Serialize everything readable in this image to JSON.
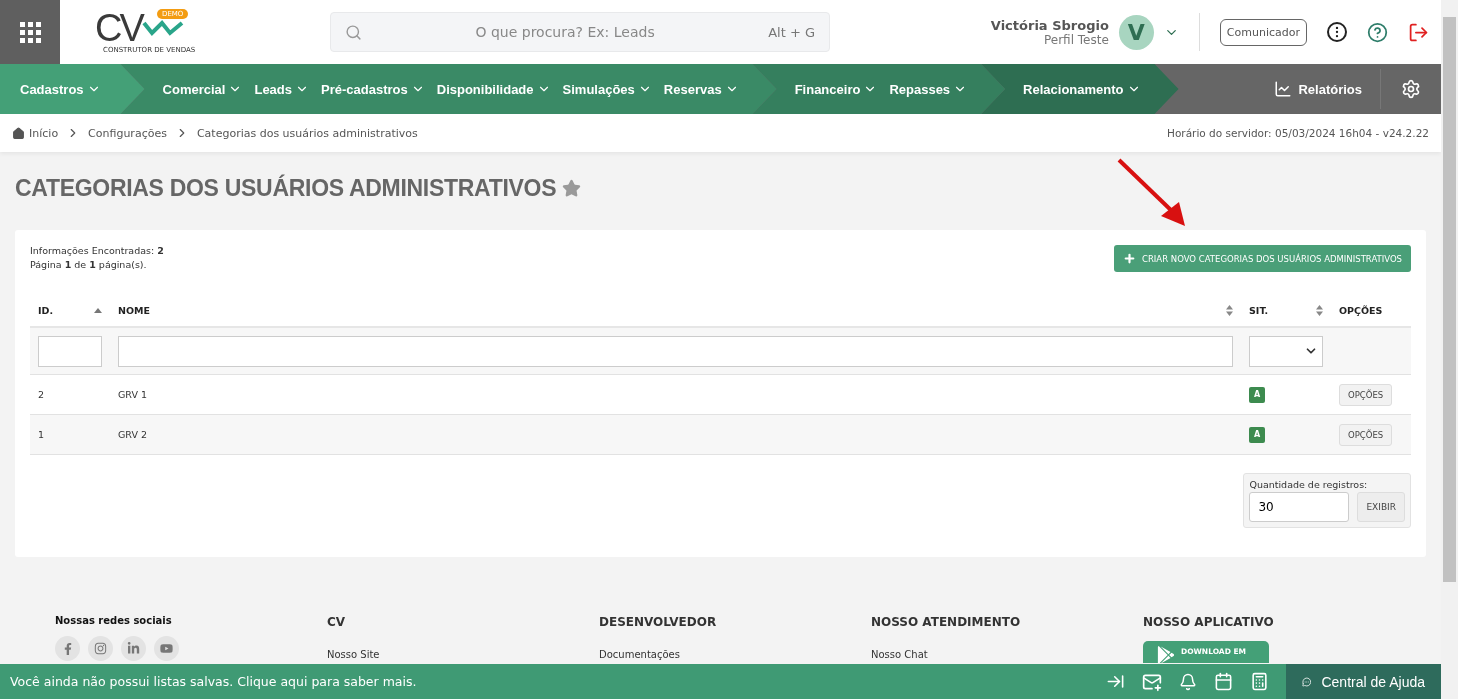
{
  "header": {
    "logo": {
      "letters": "CV",
      "badge": "DEMO",
      "tagline": "CONSTRUTOR DE VENDAS"
    },
    "search": {
      "placeholder": "O que procura? Ex: Leads",
      "shortcut": "Alt + G"
    },
    "user": {
      "name": "Victória Sbrogio",
      "profile": "Perfil Teste",
      "initial": "V"
    },
    "communicator_button": "Comunicador"
  },
  "nav": {
    "groups": [
      {
        "color": "#44a077",
        "items": [
          "Cadastros"
        ]
      },
      {
        "color": "#3a8a66",
        "items": [
          "Comercial",
          "Leads",
          "Pré-cadastros",
          "Disponibilidade",
          "Simulações",
          "Reservas"
        ]
      },
      {
        "color": "#357f5e",
        "items": [
          "Financeiro",
          "Repasses"
        ]
      },
      {
        "color": "#2e6e52",
        "items": [
          "Relacionamento"
        ]
      }
    ],
    "reports": "Relatórios"
  },
  "breadcrumb": [
    "Início",
    "Configurações",
    "Categorias dos usuários administrativos"
  ],
  "server_time": "Horário do servidor: 05/03/2024 16h04 - v24.2.22",
  "page": {
    "title": "CATEGORIAS DOS USUÁRIOS ADMINISTRATIVOS",
    "favorite": false
  },
  "summary": {
    "found": "Informações Encontradas: **2**",
    "pages": "Página **1** de **1** página(s)."
  },
  "create_button": "CRIAR NOVO CATEGORIAS DOS USUÁRIOS ADMINISTRATIVOS",
  "table": {
    "columns": [
      {
        "label": "ID.",
        "kind": "sorted"
      },
      {
        "label": "NOME",
        "kind": "sortable"
      },
      {
        "label": "SIT.",
        "kind": "sortable"
      },
      {
        "label": "OPÇÕES",
        "kind": "plain"
      }
    ],
    "rows": [
      {
        "id": "2",
        "name": "GRV 1",
        "status": "A",
        "options": "OPÇÕES"
      },
      {
        "id": "1",
        "name": "GRV 2",
        "status": "A",
        "options": "OPÇÕES"
      }
    ]
  },
  "page_size": {
    "label": "Quantidade de registros:",
    "value": "30",
    "button": "EXIBIR"
  },
  "footer": {
    "social_title": "Nossas redes sociais",
    "columns": [
      {
        "title": "CV",
        "links": [
          "Nosso Site"
        ]
      },
      {
        "title": "DESENVOLVEDOR",
        "links": [
          "Documentações"
        ]
      },
      {
        "title": "NOSSO ATENDIMENTO",
        "links": [
          "Nosso Chat"
        ]
      },
      {
        "title": "NOSSO APLICATIVO",
        "store": {
          "small": "DOWNLOAD EM"
        }
      }
    ]
  },
  "bottom_bar": {
    "message": "Você ainda não possui listas salvas. Clique aqui para saber mais.",
    "help": "Central de Ajuda"
  }
}
